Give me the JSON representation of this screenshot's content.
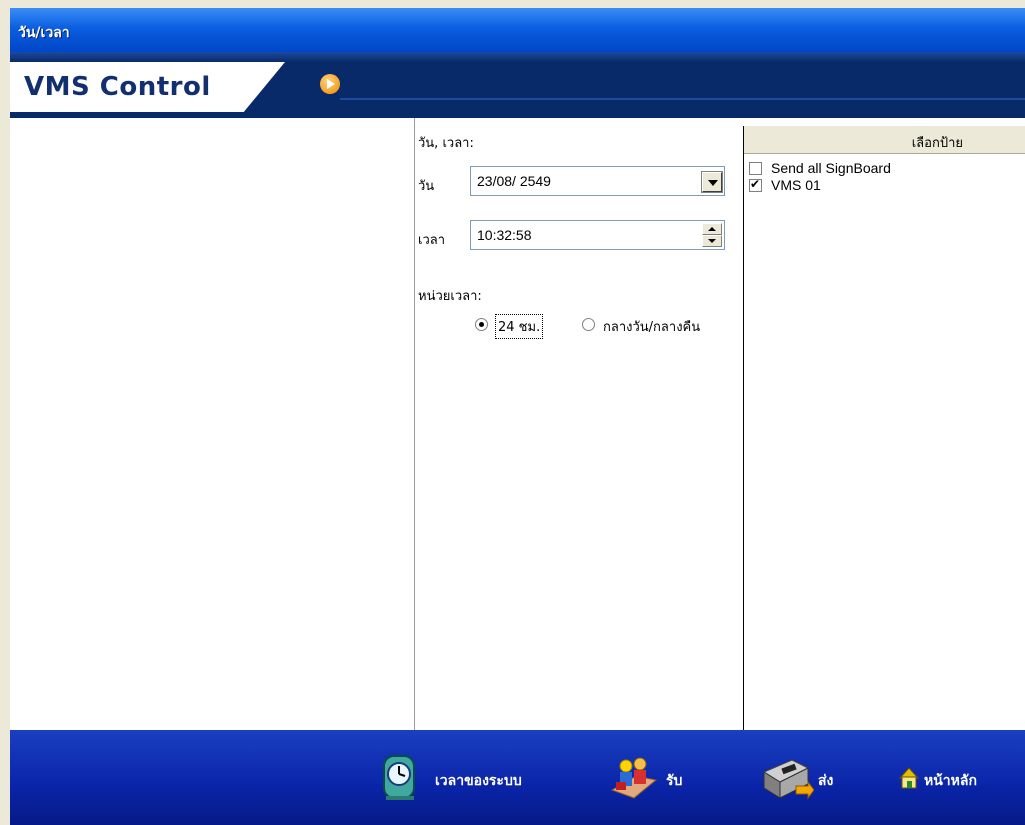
{
  "window": {
    "title": "วัน/เวลา"
  },
  "header": {
    "logo": "VMS Control",
    "play_icon": "play-circle-icon"
  },
  "datetime": {
    "section_label": "วัน, เวลา:",
    "date_label": "วัน",
    "date_value": "23/08/ 2549",
    "time_label": "เวลา",
    "time_value": "10:32:58",
    "unit_label": "หน่วยเวลา:",
    "unit_options": [
      {
        "label": "24 ชม.",
        "selected": true
      },
      {
        "label": "กลางวัน/กลางคืน",
        "selected": false
      }
    ]
  },
  "signboards": {
    "header": "เลือกป้าย",
    "items": [
      {
        "label": "Send all SignBoard",
        "checked": false
      },
      {
        "label": "VMS 01",
        "checked": true
      }
    ]
  },
  "toolbar": {
    "items": [
      {
        "label": "เวลาของระบบ",
        "icon": "clock-icon"
      },
      {
        "label": "รับ",
        "icon": "receive-icon"
      },
      {
        "label": "ส่ง",
        "icon": "send-icon"
      },
      {
        "label": "หน้าหลัก",
        "icon": "home-icon"
      }
    ]
  },
  "colors": {
    "title_bar": "#0a5fe0",
    "header_bg": "#082a68",
    "toolbar_bg": "#0a24a8",
    "accent_orange": "#f08a00"
  }
}
